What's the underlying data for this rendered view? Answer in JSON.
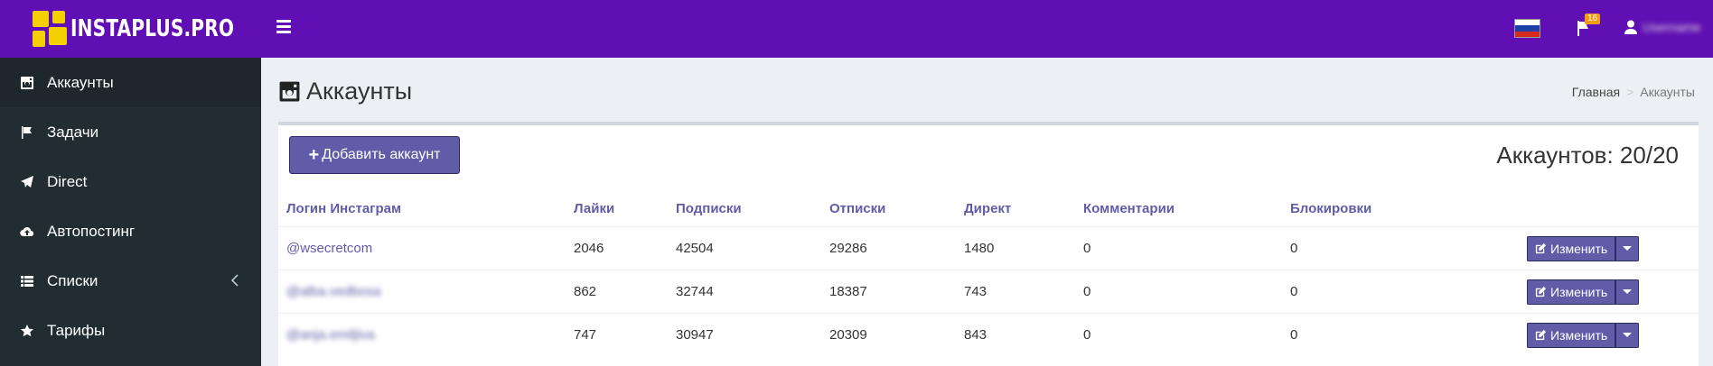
{
  "brand": {
    "name": "INSTAPLUS.PRO",
    "accent": "#5f0fb3",
    "logo_color": "#f4d000"
  },
  "topbar": {
    "notification_count": "16",
    "user_name": "Username"
  },
  "sidebar": {
    "items": [
      {
        "label": "Аккаунты",
        "icon": "instagram-icon"
      },
      {
        "label": "Задачи",
        "icon": "flag-icon"
      },
      {
        "label": "Direct",
        "icon": "paper-plane-icon"
      },
      {
        "label": "Автопостинг",
        "icon": "cloud-upload-icon"
      },
      {
        "label": "Списки",
        "icon": "list-icon"
      },
      {
        "label": "Тарифы",
        "icon": "star-icon"
      }
    ]
  },
  "page": {
    "title": "Аккаунты"
  },
  "breadcrumb": {
    "home": "Главная",
    "sep": ">",
    "current": "Аккаунты"
  },
  "box": {
    "add_label": "Добавить аккаунт",
    "count_text": "Аккаунтов: 20/20"
  },
  "table": {
    "headers": [
      "Логин Инстаграм",
      "Лайки",
      "Подписки",
      "Отписки",
      "Директ",
      "Комментарии",
      "Блокировки"
    ],
    "rows": [
      {
        "login": "@wsecretcom",
        "likes": "2046",
        "follows": "42504",
        "unfollows": "29286",
        "direct": "1480",
        "comments": "0",
        "blocks": "0"
      },
      {
        "login": "@alba.vedbosa",
        "likes": "862",
        "follows": "32744",
        "unfollows": "18387",
        "direct": "743",
        "comments": "0",
        "blocks": "0"
      },
      {
        "login": "@anja.emiljiva",
        "likes": "747",
        "follows": "30947",
        "unfollows": "20309",
        "direct": "843",
        "comments": "0",
        "blocks": "0"
      }
    ],
    "edit_label": "Изменить"
  }
}
